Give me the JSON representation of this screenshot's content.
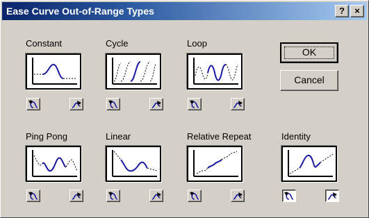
{
  "window": {
    "title": "Ease Curve Out-of-Range Types",
    "help_label": "?",
    "close_label": "×"
  },
  "buttons": {
    "ok_label": "OK",
    "cancel_label": "Cancel"
  },
  "types": [
    {
      "id": "constant",
      "label": "Constant",
      "icon": "constant-curve-icon"
    },
    {
      "id": "cycle",
      "label": "Cycle",
      "icon": "cycle-curve-icon"
    },
    {
      "id": "loop",
      "label": "Loop",
      "icon": "loop-curve-icon"
    },
    {
      "id": "ping-pong",
      "label": "Ping Pong",
      "icon": "ping-pong-curve-icon"
    },
    {
      "id": "linear",
      "label": "Linear",
      "icon": "linear-curve-icon"
    },
    {
      "id": "relative-repeat",
      "label": "Relative Repeat",
      "icon": "relative-repeat-curve-icon"
    },
    {
      "id": "identity",
      "label": "Identity",
      "icon": "identity-curve-icon"
    }
  ],
  "range_buttons": {
    "in_icon": "out-of-range-in-icon",
    "out_icon": "out-of-range-out-icon"
  },
  "colors": {
    "curve": "#1a1aa0",
    "titlebar_start": "#0a246a",
    "titlebar_end": "#a6caf0"
  }
}
